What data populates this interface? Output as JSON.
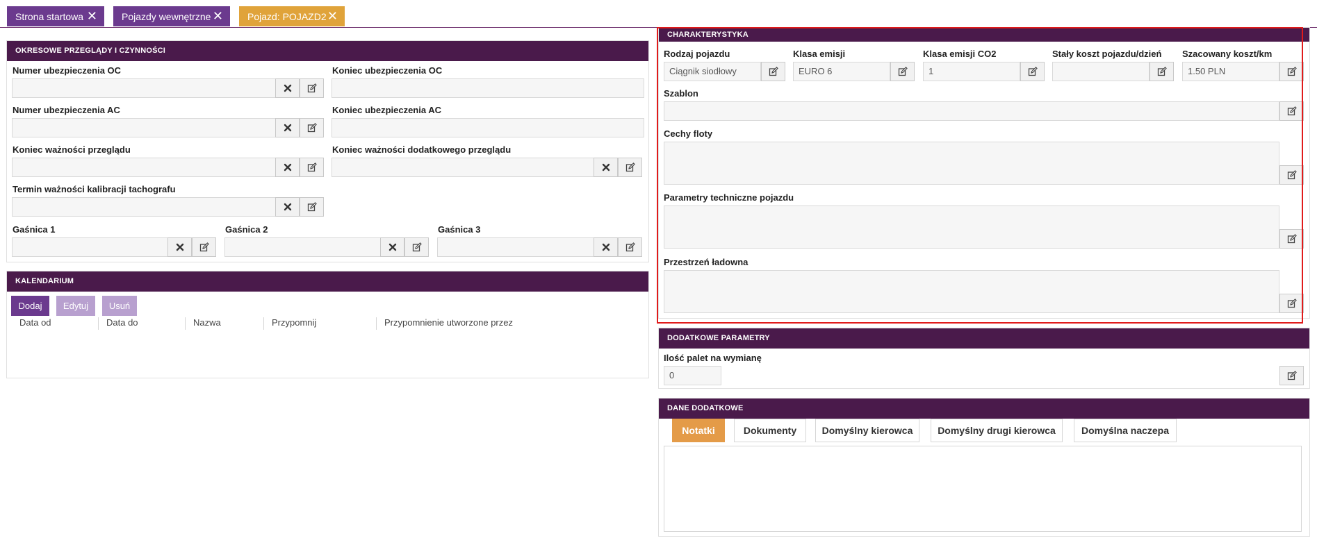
{
  "tabs": [
    {
      "label": "Strona startowa",
      "close": "✕"
    },
    {
      "label": "Pojazdy wewnętrzne",
      "close": "✕"
    },
    {
      "label": "Pojazd: POJAZD2",
      "close": "✕"
    }
  ],
  "periodic": {
    "title": "OKRESOWE PRZEGLĄDY I CZYNNOŚCI",
    "oc_number_label": "Numer ubezpieczenia OC",
    "oc_number_value": "",
    "oc_end_label": "Koniec ubezpieczenia OC",
    "oc_end_value": "",
    "ac_number_label": "Numer ubezpieczenia AC",
    "ac_number_value": "",
    "ac_end_label": "Koniec ubezpieczenia AC",
    "ac_end_value": "",
    "inspection_end_label": "Koniec ważności przeglądu",
    "inspection_end_value": "",
    "extra_inspection_end_label": "Koniec ważności dodatkowego przeglądu",
    "extra_inspection_end_value": "",
    "tacho_label": "Termin ważności kalibracji tachografu",
    "tacho_value": "",
    "extinguisher1_label": "Gaśnica 1",
    "extinguisher1_value": "",
    "extinguisher2_label": "Gaśnica 2",
    "extinguisher2_value": "",
    "extinguisher3_label": "Gaśnica 3",
    "extinguisher3_value": ""
  },
  "calendar": {
    "title": "KALENDARIUM",
    "add_label": "Dodaj",
    "edit_label": "Edytuj",
    "delete_label": "Usuń",
    "columns": [
      "Data od",
      "Data do",
      "Nazwa",
      "Przypomnij",
      "Przypomnienie utworzone przez"
    ]
  },
  "characteristics": {
    "title": "CHARAKTERYSTYKA",
    "vehicle_type_label": "Rodzaj pojazdu",
    "vehicle_type_value": "Ciągnik siodłowy",
    "emission_class_label": "Klasa emisji",
    "emission_class_value": "EURO 6",
    "co2_class_label": "Klasa emisji CO2",
    "co2_class_value": "1",
    "fixed_cost_label": "Stały koszt pojazdu/dzień",
    "fixed_cost_value": "",
    "est_cost_label": "Szacowany koszt/km",
    "est_cost_value": "1.50 PLN",
    "template_label": "Szablon",
    "template_value": "",
    "fleet_label": "Cechy floty",
    "tech_params_label": "Parametry techniczne pojazdu",
    "cargo_label": "Przestrzeń ładowna"
  },
  "extra_params": {
    "title": "DODATKOWE PARAMETRY",
    "pallets_label": "Ilość palet na wymianę",
    "pallets_value": "0"
  },
  "additional_data": {
    "title": "DANE DODATKOWE",
    "tabs": [
      "Notatki",
      "Dokumenty",
      "Domyślny kierowca",
      "Domyślny drugi kierowca",
      "Domyślna naczepa"
    ]
  },
  "colors": {
    "header": "#4a1a4b",
    "tab_purple": "#6b3a8e",
    "tab_gold": "#e0a33a",
    "active_tab": "#e49b48",
    "highlight": "#e01b1b"
  },
  "icons": {
    "clear": "clear-icon",
    "edit": "edit-icon",
    "close": "close-icon"
  }
}
